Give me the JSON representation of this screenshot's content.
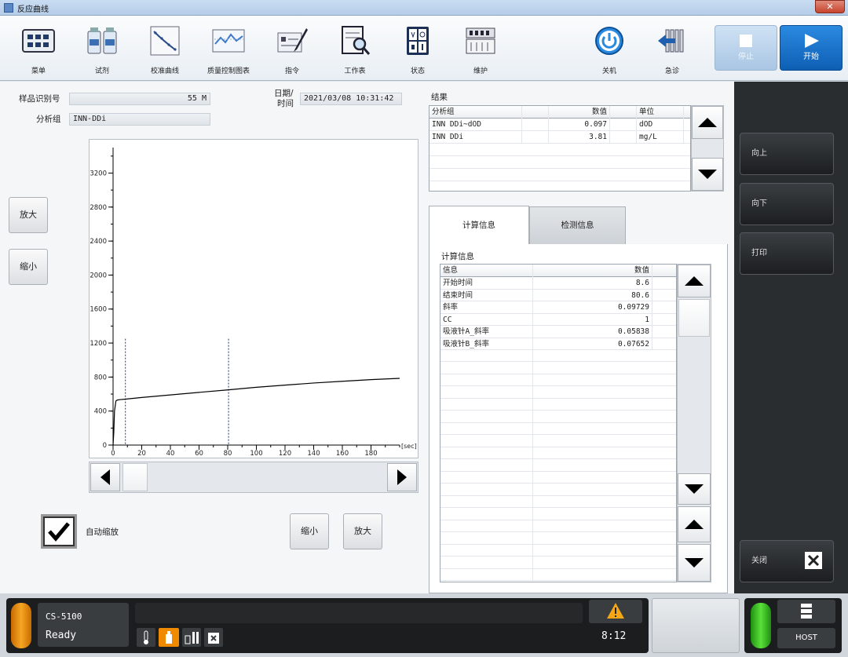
{
  "window": {
    "title": "反应曲线",
    "close_glyph": "✕"
  },
  "toolbar": {
    "items": [
      {
        "label": "菜单",
        "icon": "menu-grid-icon"
      },
      {
        "label": "试剂",
        "icon": "reagent-bottles-icon"
      },
      {
        "label": "校准曲线",
        "icon": "calibration-curve-icon"
      },
      {
        "label": "质量控制图表",
        "icon": "qc-chart-icon"
      },
      {
        "label": "指令",
        "icon": "order-pen-icon"
      },
      {
        "label": "工作表",
        "icon": "worksheet-magnifier-icon"
      },
      {
        "label": "状态",
        "icon": "status-icon"
      },
      {
        "label": "维护",
        "icon": "maintenance-icon"
      },
      {
        "label": "关机",
        "icon": "power-icon"
      },
      {
        "label": "急诊",
        "icon": "stat-rack-icon"
      }
    ],
    "stop_label": "停止",
    "start_label": "开始"
  },
  "sample": {
    "id_label": "样品识别号",
    "id_value": "55 M",
    "group_label": "分析组",
    "group_value": "INN-DDi",
    "datetime_label_1": "日期/",
    "datetime_label_2": "时间",
    "datetime_value": "2021/03/08 10:31:42"
  },
  "zoom": {
    "zoom_in": "放大",
    "zoom_out": "缩小",
    "auto_zoom_label": "自动缩放",
    "auto_zoom_checked": true
  },
  "chart_data": {
    "type": "line",
    "x_unit_label": "[sec]",
    "xlim": [
      0,
      200
    ],
    "ylim": [
      0,
      3500
    ],
    "x_ticks": [
      0,
      20,
      40,
      60,
      80,
      100,
      120,
      140,
      160,
      180
    ],
    "y_ticks": [
      0,
      400,
      800,
      1200,
      1600,
      2000,
      2400,
      2800,
      3200
    ],
    "series": [
      {
        "x": [
          0,
          0.5,
          1,
          2,
          3,
          5,
          8.6,
          20,
          40,
          60,
          80.6,
          100,
          120,
          140,
          160,
          180,
          200
        ],
        "y": [
          0,
          150,
          400,
          520,
          530,
          535,
          540,
          560,
          590,
          620,
          650,
          680,
          705,
          730,
          750,
          770,
          785
        ]
      }
    ],
    "markers": [
      {
        "x": 8.6,
        "color": "#1a2a9a"
      },
      {
        "x": 80.6,
        "color": "#1a2a9a"
      }
    ],
    "marker_top": 1250
  },
  "results": {
    "section_label": "结果",
    "columns": [
      "分析组",
      "数值",
      "单位"
    ],
    "rows": [
      {
        "group": "INN DDi~dOD",
        "value": "0.097",
        "unit": "dOD"
      },
      {
        "group": "INN DDi",
        "value": "3.81",
        "unit": "mg/L"
      }
    ]
  },
  "tabs": [
    {
      "label": "计算信息",
      "active": true
    },
    {
      "label": "检测信息",
      "active": false
    }
  ],
  "calc": {
    "section_label": "计算信息",
    "columns": [
      "信息",
      "数值"
    ],
    "rows": [
      {
        "info": "开始时间",
        "value": "8.6"
      },
      {
        "info": "结束时间",
        "value": "80.6"
      },
      {
        "info": "斜率",
        "value": "0.09729"
      },
      {
        "info": "CC",
        "value": "1"
      },
      {
        "info": "吸液针A_斜率",
        "value": "0.05838"
      },
      {
        "info": "吸液针B_斜率",
        "value": "0.07652"
      }
    ]
  },
  "sidebar": {
    "up": "向上",
    "down": "向下",
    "print": "打印",
    "close": "关闭"
  },
  "status": {
    "model": "CS-5100",
    "state": "Ready",
    "time": "8:12",
    "host": "HOST"
  },
  "colors": {
    "accent": "#0e6fc9",
    "sidebar": "#2a2d30",
    "status_orange": "#f0a020",
    "status_green": "#3ec21c",
    "warn": "#f3a616"
  }
}
